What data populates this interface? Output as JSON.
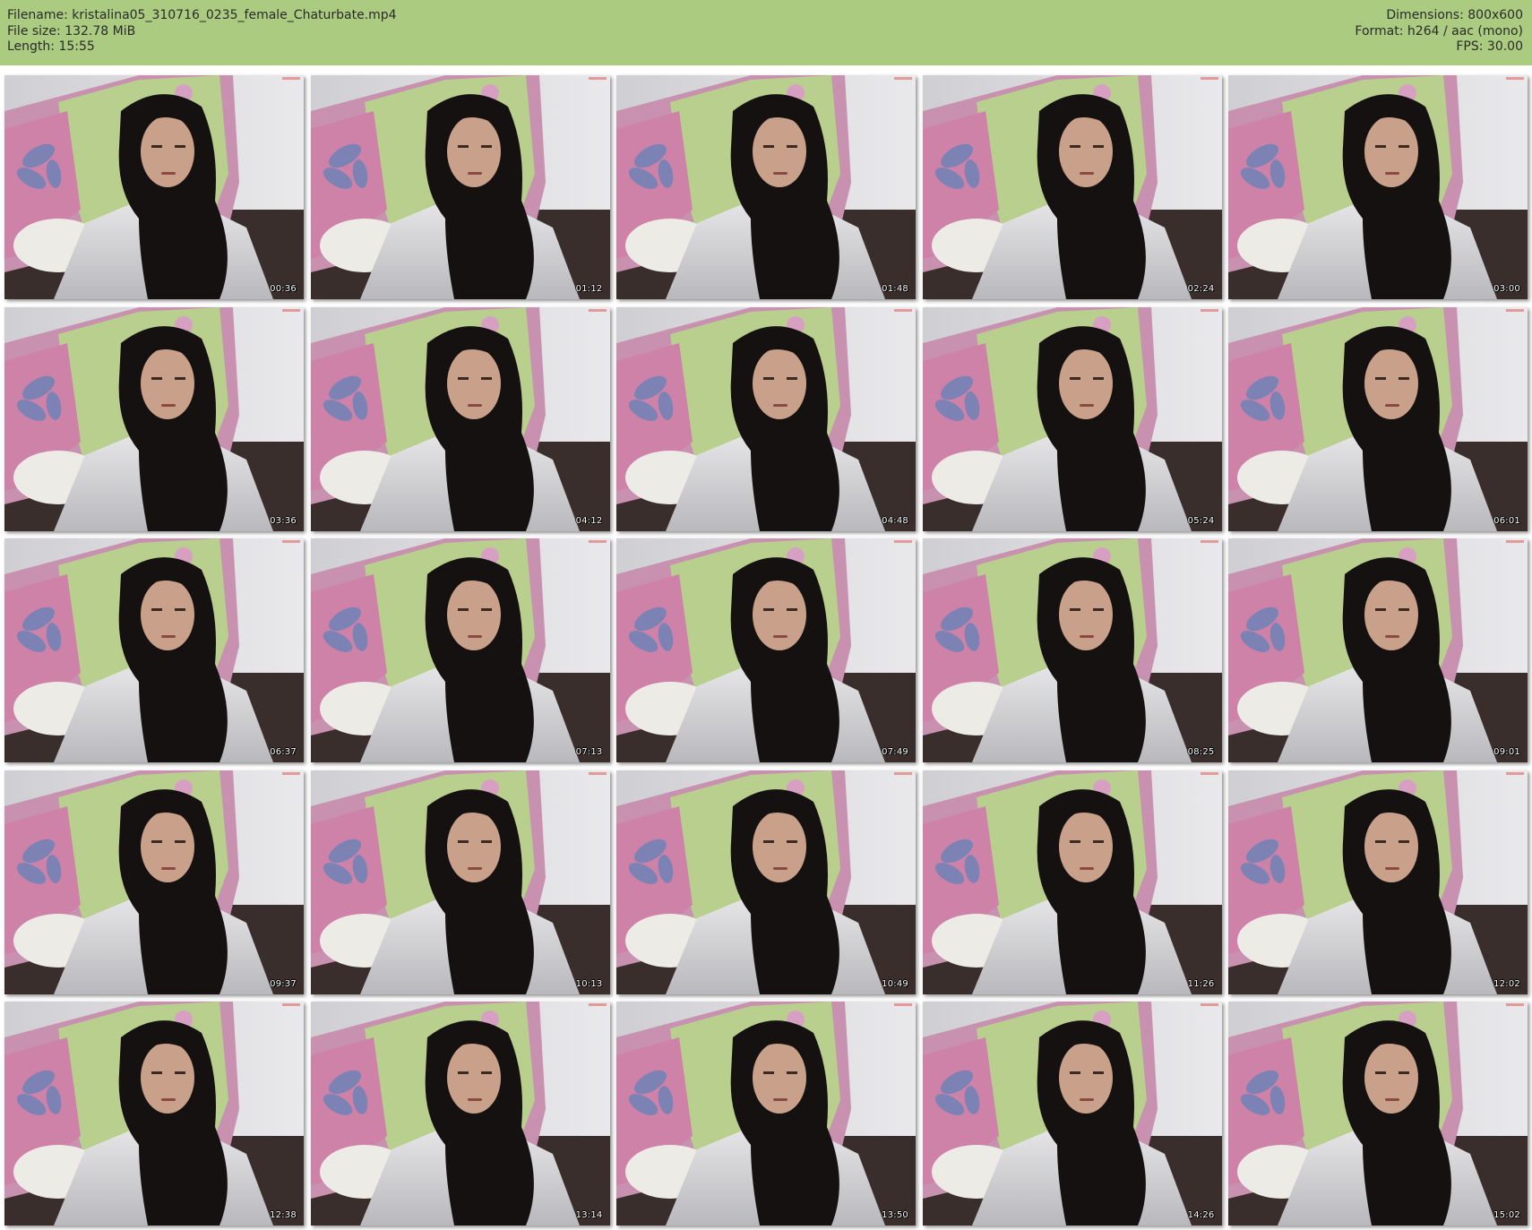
{
  "header": {
    "filename_line": "Filename: kristalina05_310716_0235_female_Chaturbate.mp4",
    "filesize_line": "File size: 132.78 MiB",
    "length_line": "Length: 15:55",
    "dimensions_line": "Dimensions: 800x600",
    "format_line": "Format: h264 / aac (mono)",
    "fps_line": "FPS: 30.00"
  },
  "colors": {
    "header_bg": "#abcb81",
    "background": "#ffffff"
  },
  "thumbnails": [
    {
      "timestamp": "00:36"
    },
    {
      "timestamp": "01:12"
    },
    {
      "timestamp": "01:48"
    },
    {
      "timestamp": "02:24"
    },
    {
      "timestamp": "03:00"
    },
    {
      "timestamp": "03:36"
    },
    {
      "timestamp": "04:12"
    },
    {
      "timestamp": "04:48"
    },
    {
      "timestamp": "05:24"
    },
    {
      "timestamp": "06:01"
    },
    {
      "timestamp": "06:37"
    },
    {
      "timestamp": "07:13"
    },
    {
      "timestamp": "07:49"
    },
    {
      "timestamp": "08:25"
    },
    {
      "timestamp": "09:01"
    },
    {
      "timestamp": "09:37"
    },
    {
      "timestamp": "10:13"
    },
    {
      "timestamp": "10:49"
    },
    {
      "timestamp": "11:26"
    },
    {
      "timestamp": "12:02"
    },
    {
      "timestamp": "12:38"
    },
    {
      "timestamp": "13:14"
    },
    {
      "timestamp": "13:50"
    },
    {
      "timestamp": "14:26"
    },
    {
      "timestamp": "15:02"
    }
  ]
}
